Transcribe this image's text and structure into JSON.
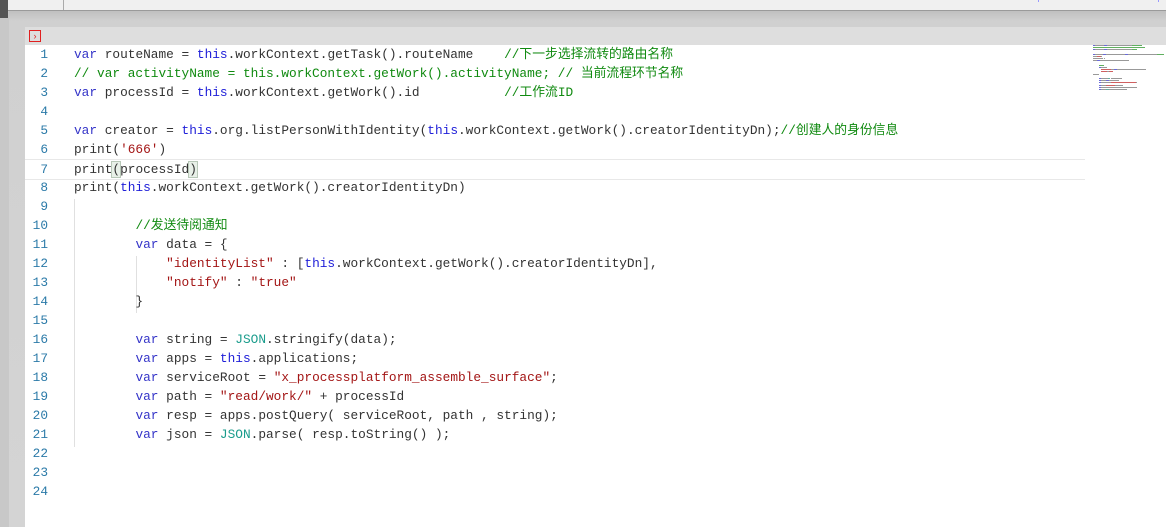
{
  "editor": {
    "run_icon": "run-icon",
    "current_line": 7,
    "lines": [
      [
        [
          "kw",
          "var"
        ],
        [
          "pl",
          " routeName = "
        ],
        [
          "th",
          "this"
        ],
        [
          "pl",
          ".workContext.getTask().routeName    "
        ],
        [
          "cm",
          "//下一步选择流转的路由名称"
        ]
      ],
      [
        [
          "cm",
          "// var activityName = this.workContext.getWork().activityName; // 当前流程环节名称"
        ]
      ],
      [
        [
          "kw",
          "var"
        ],
        [
          "pl",
          " processId = "
        ],
        [
          "th",
          "this"
        ],
        [
          "pl",
          ".workContext.getWork().id           "
        ],
        [
          "cm",
          "//工作流ID"
        ]
      ],
      [],
      [
        [
          "kw",
          "var"
        ],
        [
          "pl",
          " creator = "
        ],
        [
          "th",
          "this"
        ],
        [
          "pl",
          ".org.listPersonWithIdentity("
        ],
        [
          "th",
          "this"
        ],
        [
          "pl",
          ".workContext.getWork().creatorIdentityDn);"
        ],
        [
          "cm",
          "//创建人的身份信息"
        ]
      ],
      [
        [
          "pl",
          "print("
        ],
        [
          "st",
          "'666'"
        ],
        [
          "pl",
          ")"
        ]
      ],
      [
        [
          "pl",
          "print"
        ],
        [
          "br",
          "("
        ],
        [
          "pl",
          "processId"
        ],
        [
          "br",
          ")"
        ]
      ],
      [
        [
          "pl",
          "print("
        ],
        [
          "th",
          "this"
        ],
        [
          "pl",
          ".workContext.getWork().creatorIdentityDn)"
        ]
      ],
      [],
      [
        [
          "pl",
          "        "
        ],
        [
          "cm",
          "//发送待阅通知"
        ]
      ],
      [
        [
          "pl",
          "        "
        ],
        [
          "kw",
          "var"
        ],
        [
          "pl",
          " data = {"
        ]
      ],
      [
        [
          "pl",
          "            "
        ],
        [
          "st",
          "\"identityList\""
        ],
        [
          "pl",
          " : ["
        ],
        [
          "th",
          "this"
        ],
        [
          "pl",
          ".workContext.getWork().creatorIdentityDn],"
        ]
      ],
      [
        [
          "pl",
          "            "
        ],
        [
          "st",
          "\"notify\""
        ],
        [
          "pl",
          " : "
        ],
        [
          "st",
          "\"true\""
        ]
      ],
      [
        [
          "pl",
          "        }"
        ]
      ],
      [],
      [
        [
          "pl",
          "        "
        ],
        [
          "kw",
          "var"
        ],
        [
          "pl",
          " string = "
        ],
        [
          "js",
          "JSON"
        ],
        [
          "pl",
          ".stringify(data);"
        ]
      ],
      [
        [
          "pl",
          "        "
        ],
        [
          "kw",
          "var"
        ],
        [
          "pl",
          " apps = "
        ],
        [
          "th",
          "this"
        ],
        [
          "pl",
          ".applications;"
        ]
      ],
      [
        [
          "pl",
          "        "
        ],
        [
          "kw",
          "var"
        ],
        [
          "pl",
          " serviceRoot = "
        ],
        [
          "st",
          "\"x_processplatform_assemble_surface\""
        ],
        [
          "pl",
          ";"
        ]
      ],
      [
        [
          "pl",
          "        "
        ],
        [
          "kw",
          "var"
        ],
        [
          "pl",
          " path = "
        ],
        [
          "st",
          "\"read/work/\""
        ],
        [
          "pl",
          " + processId"
        ]
      ],
      [
        [
          "pl",
          "        "
        ],
        [
          "kw",
          "var"
        ],
        [
          "pl",
          " resp = apps.postQuery( serviceRoot, path , string);"
        ]
      ],
      [
        [
          "pl",
          "        "
        ],
        [
          "kw",
          "var"
        ],
        [
          "pl",
          " json = "
        ],
        [
          "js",
          "JSON"
        ],
        [
          "pl",
          ".parse( resp.toString() );"
        ]
      ],
      [],
      [],
      []
    ]
  }
}
